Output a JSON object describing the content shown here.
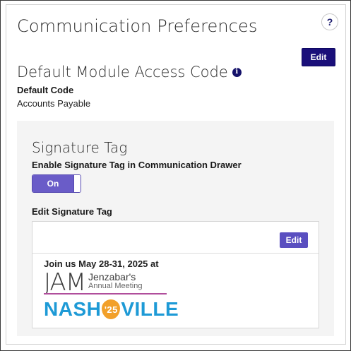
{
  "header": {
    "title": "Communication Preferences",
    "help_label": "?"
  },
  "module_access": {
    "edit_label": "Edit",
    "title": "Default Module Access Code",
    "info_glyph": "i",
    "field_label": "Default Code",
    "field_value": "Accounts Payable"
  },
  "signature": {
    "title": "Signature Tag",
    "enable_label": "Enable Signature Tag in Communication Drawer",
    "toggle_label": "On",
    "toggle_state": true,
    "edit_section_label": "Edit Signature Tag",
    "edit_button_label": "Edit",
    "content": {
      "join_text": "Join us May 28-31, 2025 at",
      "jam_letters": "JAM",
      "jam_line1": "Jenzabar's",
      "jam_line2": "Annual Meeting",
      "nash_left": "NASH",
      "nash_year": "'25",
      "nash_right": "VILLE"
    }
  },
  "icons": {
    "help": "question-icon",
    "info": "info-icon"
  },
  "colors": {
    "primary_button": "#1a0f7a",
    "secondary_button": "#5a4fc0",
    "toggle_on": "#6a5cc8",
    "jam_accent": "#b04e9c",
    "nash_blue": "#1e9ad6",
    "nash_pick": "#f2a02a"
  }
}
